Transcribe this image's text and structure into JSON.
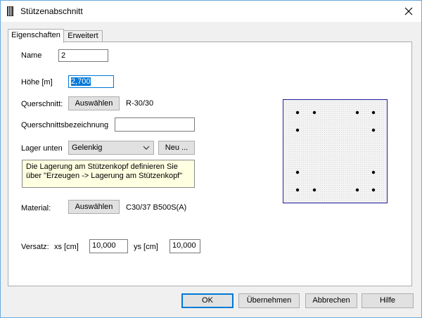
{
  "window": {
    "title": "Stützenabschnitt"
  },
  "tabs": [
    {
      "label": "Eigenschaften",
      "active": true
    },
    {
      "label": "Erweitert",
      "active": false
    }
  ],
  "form": {
    "name_label": "Name",
    "name_value": "2",
    "hoehe_label": "Höhe [m]",
    "hoehe_value": "2,700",
    "querschnitt_label": "Querschnitt:",
    "querschnitt_button": "Auswählen",
    "querschnitt_value": "R-30/30",
    "bezeichnung_label": "Querschnittsbezeichnung",
    "bezeichnung_value": "",
    "lager_label": "Lager unten",
    "lager_selected": "Gelenkig",
    "lager_new_button": "Neu ...",
    "info_text": "Die Lagerung am Stützenkopf definieren Sie über \"Erzeugen -> Lagerung am Stützenkopf\"",
    "material_label": "Material:",
    "material_button": "Auswählen",
    "material_value": "C30/37 B500S(A)",
    "versatz_label": "Versatz:",
    "xs_label": "xs [cm]",
    "xs_value": "10,000",
    "ys_label": "ys [cm]",
    "ys_value": "10,000"
  },
  "footer": {
    "ok": "OK",
    "apply": "Übernehmen",
    "cancel": "Abbrechen",
    "help": "Hilfe"
  },
  "colors": {
    "accent": "#0078d7",
    "preview_border": "#1f1fa0",
    "info_background": "#ffffe1"
  }
}
